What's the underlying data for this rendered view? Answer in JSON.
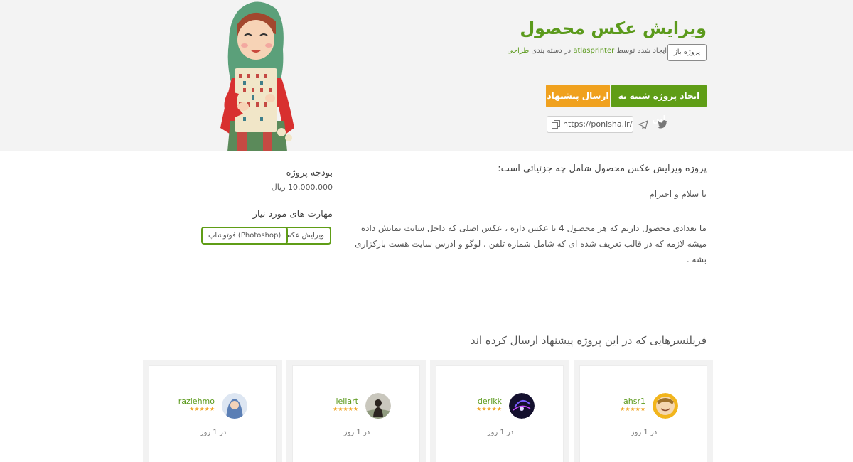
{
  "header": {
    "title": "ویرایش عکس محصول",
    "status": "پروژه باز",
    "created_by_prefix": "ایجاد شده توسط",
    "owner": "atlasprinter",
    "category_prefix": "در دسته بندی",
    "category": "طراحی"
  },
  "actions": {
    "create_similar": "ایجاد پروژه شبیه به این",
    "send_proposal": "ارسال پیشنهاد"
  },
  "share": {
    "url": "https://ponisha.ir/pr"
  },
  "description": {
    "heading": "پروژه ویرایش عکس محصول شامل چه جزئیاتی است:",
    "greeting": "با سلام و احترام",
    "body": "ما تعدادی محصول داریم که هر محصول 4 تا عکس داره ، عکس اصلی که داخل سایت نمایش داده میشه لازمه که در قالب تعریف شده ای که شامل شماره تلفن ، لوگو و ادرس سایت هست بارکزاری بشه ."
  },
  "sidebar": {
    "budget_label": "بودجه پروژه",
    "budget_value": "10.000.000 ریال",
    "skills_label": "مهارت های مورد نیاز",
    "skills": [
      "ویرایش عکس",
      "فوتوشاپ (Photoshop)"
    ]
  },
  "freelancers": {
    "title": "فریلنسرهایی که در این پروژه پیشنهاد ارسال کرده اند",
    "items": [
      {
        "name": "ahsr1",
        "stars": "★★★★★",
        "time": "در 1 روز"
      },
      {
        "name": "derikk",
        "stars": "★★★★★",
        "time": "در 1 روز"
      },
      {
        "name": "leilart",
        "stars": "★★★★★",
        "time": "در 1 روز"
      },
      {
        "name": "raziehmo",
        "stars": "★★★★★",
        "time": "در 1 روز"
      }
    ]
  },
  "colors": {
    "accent_green": "#5f9d16",
    "accent_orange": "#f0a11e",
    "hero_bg": "#f3f3f3"
  }
}
